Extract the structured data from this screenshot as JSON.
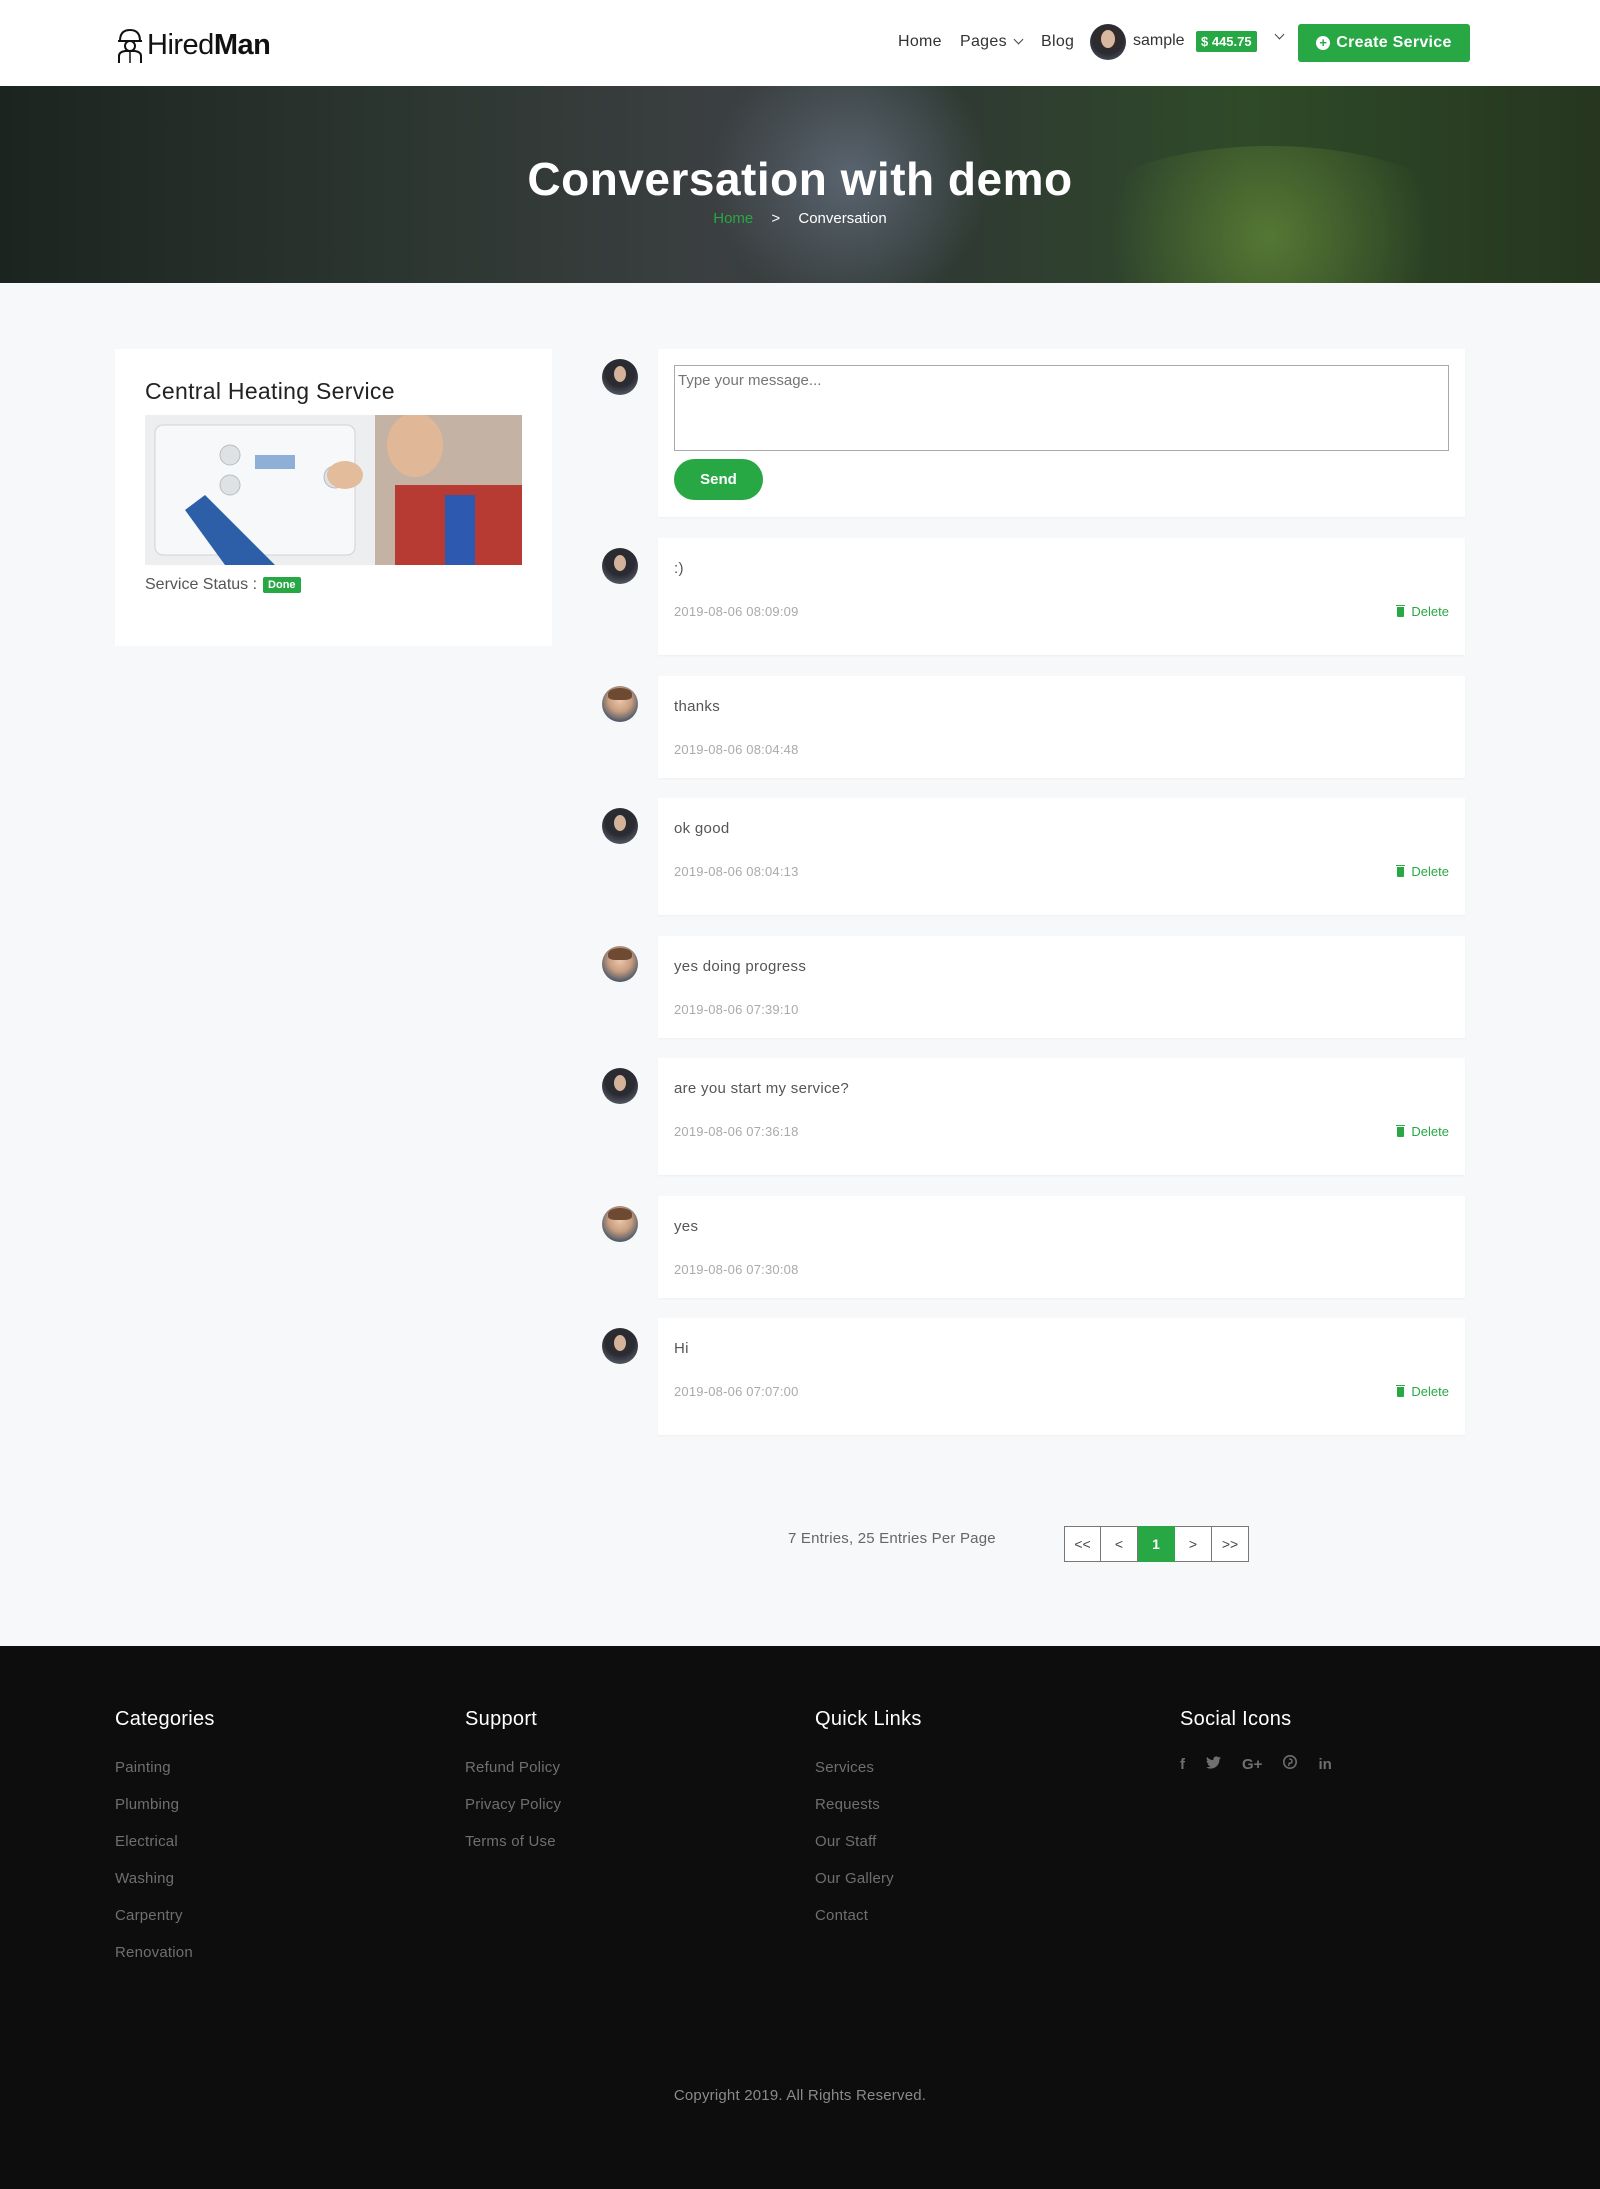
{
  "brand": {
    "name_light": "Hired",
    "name_bold": "Man"
  },
  "nav": {
    "home": "Home",
    "pages": "Pages",
    "blog": "Blog",
    "user": "sample",
    "balance": "$ 445.75",
    "create": "Create Service"
  },
  "hero": {
    "title": "Conversation with demo",
    "crumb_home": "Home",
    "crumb_sep": ">",
    "crumb_current": "Conversation"
  },
  "service": {
    "title": "Central Heating Service",
    "status_label": "Service Status :",
    "status_value": "Done"
  },
  "compose": {
    "placeholder": "Type your message...",
    "send": "Send"
  },
  "messages": [
    {
      "text": ":)",
      "time": "2019-08-06 08:09:09",
      "delete": "Delete",
      "author": "sample"
    },
    {
      "text": "thanks",
      "time": "2019-08-06 08:04:48",
      "author": "demo"
    },
    {
      "text": "ok good",
      "time": "2019-08-06 08:04:13",
      "delete": "Delete",
      "author": "sample"
    },
    {
      "text": "yes doing progress",
      "time": "2019-08-06 07:39:10",
      "author": "demo"
    },
    {
      "text": "are you start my service?",
      "time": "2019-08-06 07:36:18",
      "delete": "Delete",
      "author": "sample"
    },
    {
      "text": "yes",
      "time": "2019-08-06 07:30:08",
      "author": "demo"
    },
    {
      "text": "Hi",
      "time": "2019-08-06 07:07:00",
      "delete": "Delete",
      "author": "sample"
    }
  ],
  "pagination": {
    "summary": "7 Entries, 25 Entries Per Page",
    "first": "<<",
    "prev": "<",
    "current": "1",
    "next": ">",
    "last": ">>"
  },
  "footer": {
    "categories": {
      "title": "Categories",
      "items": [
        "Painting",
        "Plumbing",
        "Electrical",
        "Washing",
        "Carpentry",
        "Renovation"
      ]
    },
    "support": {
      "title": "Support",
      "items": [
        "Refund Policy",
        "Privacy Policy",
        "Terms of Use"
      ]
    },
    "quick": {
      "title": "Quick Links",
      "items": [
        "Services",
        "Requests",
        "Our Staff",
        "Our Gallery",
        "Contact"
      ]
    },
    "social": {
      "title": "Social Icons",
      "icons": [
        "facebook-icon",
        "twitter-icon",
        "google-plus-icon",
        "pinterest-icon",
        "linkedin-icon"
      ]
    },
    "copyright": "Copyright 2019. All Rights Reserved."
  },
  "colors": {
    "accent": "#28a745",
    "footer_bg": "#0d0d0d",
    "page_bg": "#f6f8fa"
  }
}
